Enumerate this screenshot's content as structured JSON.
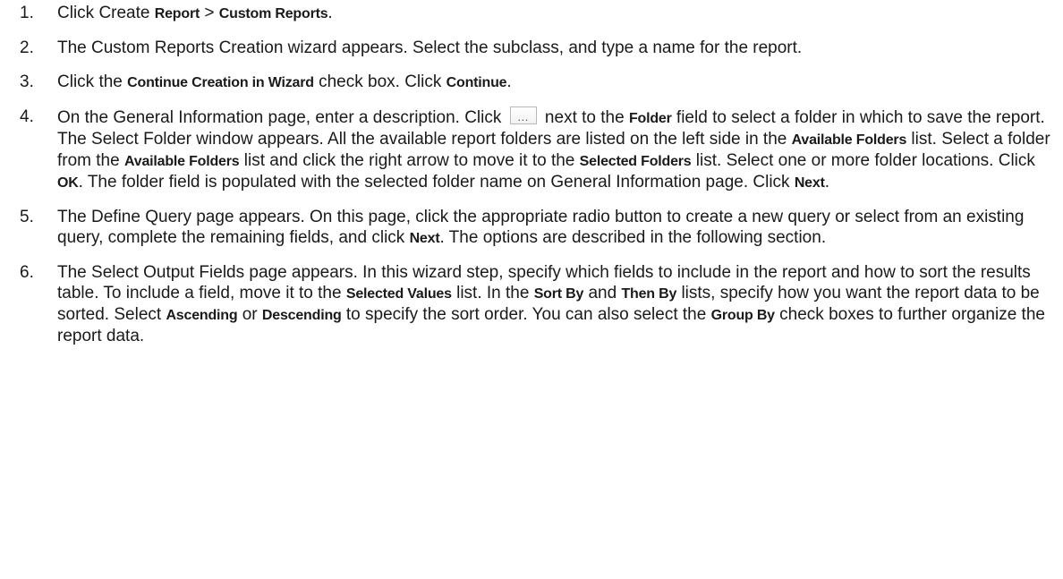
{
  "steps": [
    {
      "number": "1.",
      "segments": [
        {
          "text": "Click Create "
        },
        {
          "text": "Report",
          "bold": true
        },
        {
          "text": " > "
        },
        {
          "text": "Custom Reports",
          "bold": true
        },
        {
          "text": "."
        }
      ]
    },
    {
      "number": "2.",
      "segments": [
        {
          "text": "The Custom Reports Creation wizard appears. Select the subclass, and type a name for the report."
        }
      ]
    },
    {
      "number": "3.",
      "segments": [
        {
          "text": "Click the "
        },
        {
          "text": "Continue Creation in Wizard",
          "bold": true
        },
        {
          "text": " check box. Click "
        },
        {
          "text": "Continue",
          "bold": true
        },
        {
          "text": "."
        }
      ]
    },
    {
      "number": "4.",
      "segments": [
        {
          "text": "On the General Information page, enter a description. Click "
        },
        {
          "icon": "ellipsis-button-icon",
          "glyph": "..."
        },
        {
          "text": " next to the "
        },
        {
          "text": "Folder",
          "bold": true
        },
        {
          "text": " field to select a folder in which to save the report. The Select Folder window appears. All the available report folders are listed on the left side in the "
        },
        {
          "text": "Available Folders",
          "bold": true
        },
        {
          "text": " list. Select a folder from the "
        },
        {
          "text": "Available Folders",
          "bold": true
        },
        {
          "text": " list and click the right arrow to move it to the "
        },
        {
          "text": "Selected Folders",
          "bold": true
        },
        {
          "text": " list. Select one or more folder locations. Click "
        },
        {
          "text": "OK",
          "bold": true
        },
        {
          "text": ". The folder field is populated with the selected folder name on General Information page. Click "
        },
        {
          "text": "Next",
          "bold": true
        },
        {
          "text": "."
        }
      ]
    },
    {
      "number": "5.",
      "segments": [
        {
          "text": "The Define Query page appears. On this page, click the appropriate radio button to create a new query or select from an existing query, complete the remaining fields, and click "
        },
        {
          "text": "Next",
          "bold": true
        },
        {
          "text": ". The options are described in the following section."
        }
      ]
    },
    {
      "number": "6.",
      "segments": [
        {
          "text": "The Select Output Fields page appears. In this wizard step, specify which fields to include in the report and how to sort the results table. To include a field, move it to the "
        },
        {
          "text": "Selected Values",
          "bold": true
        },
        {
          "text": " list. In the "
        },
        {
          "text": "Sort By",
          "bold": true
        },
        {
          "text": " and "
        },
        {
          "text": "Then By",
          "bold": true
        },
        {
          "text": " lists, specify how you want the report data to be sorted. Select "
        },
        {
          "text": "Ascending",
          "bold": true
        },
        {
          "text": " or "
        },
        {
          "text": "Descending",
          "bold": true
        },
        {
          "text": " to specify the sort order. You can also select the "
        },
        {
          "text": "Group By",
          "bold": true
        },
        {
          "text": " check boxes to further organize the report data."
        }
      ]
    }
  ]
}
